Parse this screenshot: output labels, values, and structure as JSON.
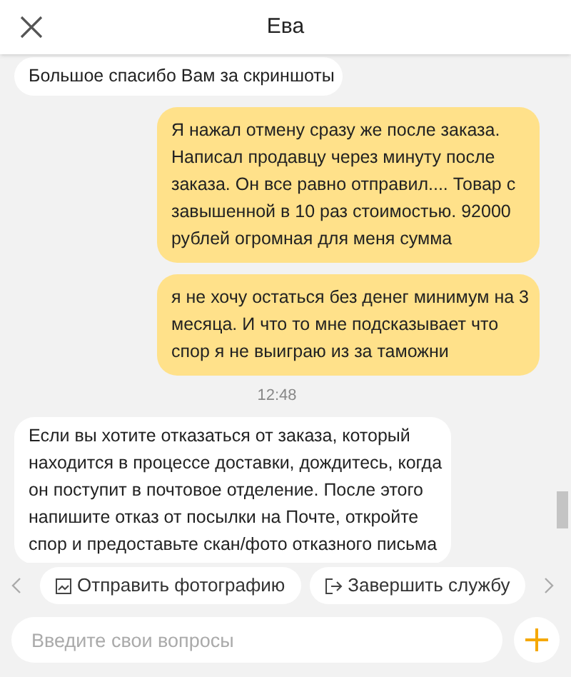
{
  "header": {
    "title": "Ева"
  },
  "messages": [
    {
      "kind": "agent",
      "text": "Большое спасибо Вам за скриншоты"
    },
    {
      "kind": "user",
      "text": "Я нажал отмену сразу же после заказа. Написал продавцу через минуту после заказа. Он все равно отправил.... Товар с завышенной в 10 раз стоимостью. 92000 рублей огромная для меня сумма"
    },
    {
      "kind": "user",
      "text": "я не хочу остаться без денег минимум на 3 месяца. И что то мне подсказывает что спор я не выиграю из за таможни"
    },
    {
      "kind": "time",
      "text": "12:48"
    },
    {
      "kind": "agent",
      "text": "Если вы хотите отказаться от заказа, который находится в процессе доставки, дождитесь, когда он поступит в почтовое отделение. После этого напишите отказ от посылки на Почте, откройте спор и предоставьте скан/фото отказного письма"
    }
  ],
  "quick_replies": [
    {
      "kind": "photo",
      "label": "Отправить фотографию"
    },
    {
      "kind": "exit",
      "label": "Завершить службу"
    }
  ],
  "input": {
    "placeholder": "Введите свои вопросы"
  }
}
